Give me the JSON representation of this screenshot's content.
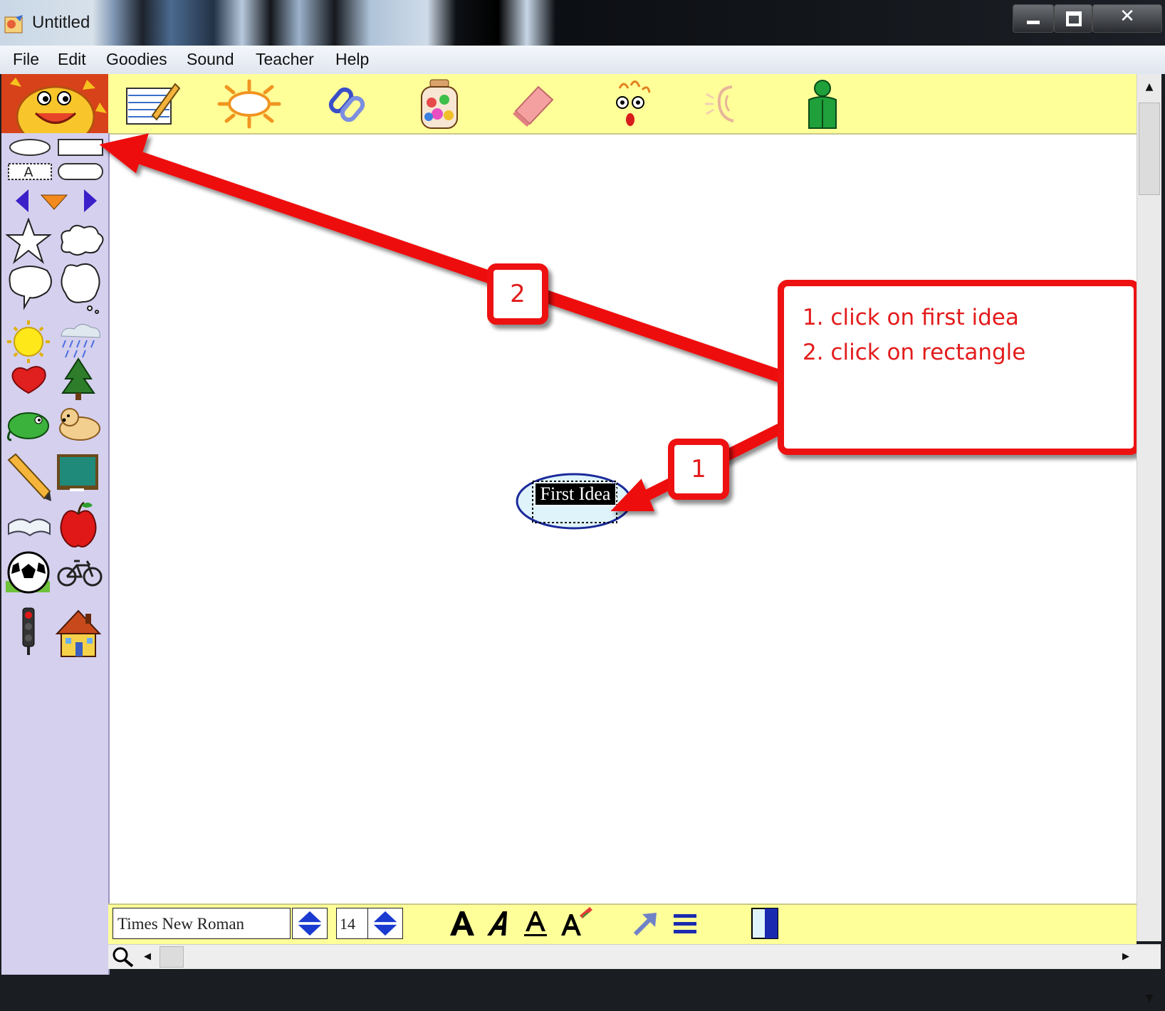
{
  "window": {
    "title": "Untitled"
  },
  "menu": {
    "items": [
      "File",
      "Edit",
      "Goodies",
      "Sound",
      "Teacher",
      "Help"
    ]
  },
  "toolbar": {
    "icons": [
      "notepad-icon",
      "sun-burst-icon",
      "chain-link-icon",
      "candy-jar-icon",
      "eraser-icon",
      "silly-face-icon",
      "listen-ear-icon",
      "person-icon"
    ]
  },
  "palette": {
    "shapes": [
      "oval-shape",
      "rectangle-shape",
      "text-box-shape",
      "rounded-rectangle-shape"
    ],
    "text_box_letter": "A",
    "stickers": [
      "star",
      "cloud",
      "speech-bubble",
      "thought-bubble",
      "sun",
      "rain-cloud",
      "heart",
      "tree",
      "lizard",
      "dog",
      "pencil",
      "chalkboard",
      "book",
      "apple",
      "soccer-ball",
      "bicycle",
      "traffic-light",
      "house"
    ]
  },
  "canvas": {
    "first_idea": "First Idea"
  },
  "annotations": {
    "note_lines": [
      "1. click on first idea",
      "2. click on rectangle"
    ],
    "step1": "1",
    "step2": "2",
    "color": "#ee1111"
  },
  "formatbar": {
    "font_name": "Times New Roman",
    "font_size": "14"
  },
  "colors": {
    "toolbar": "#ffff99",
    "palette": "#d5d0ee",
    "accent": "#ee1111"
  }
}
